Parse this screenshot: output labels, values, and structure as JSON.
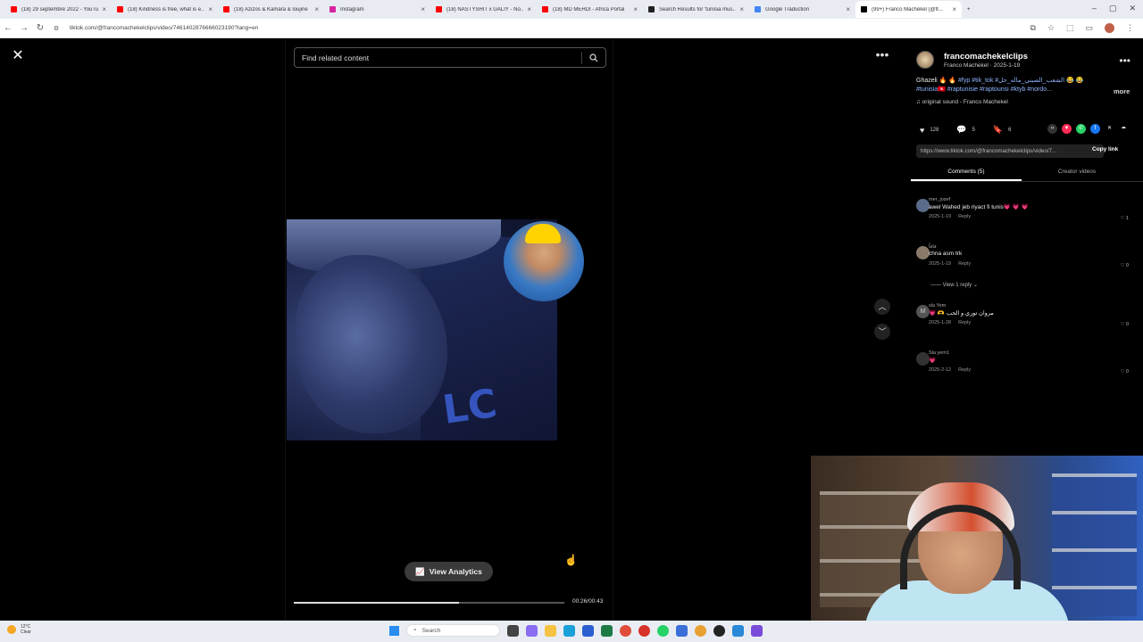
{
  "browser": {
    "tabs": [
      {
        "label": "(18) 29 septembre 2022 - YouTube",
        "color": "#ff0000"
      },
      {
        "label": "(18) Kindness is free, what is e...",
        "color": "#ff0000"
      },
      {
        "label": "(18) Azizos & Kamara & loujine",
        "color": "#ff0000"
      },
      {
        "label": "Instagram",
        "color": "#d6249f"
      },
      {
        "label": "(18) NASTYSHIT x GALIY - No...",
        "color": "#ff0000"
      },
      {
        "label": "(18) MD MEHDI - Africa Portal",
        "color": "#ff0000"
      },
      {
        "label": "Search Results for 'tunisia mus...",
        "color": "#222222"
      },
      {
        "label": "Google Traduction",
        "color": "#4285f4"
      },
      {
        "label": "(99+) Franco Machekel (@fr...",
        "color": "#000000"
      }
    ],
    "url": "tiktok.com/@francomachekelclips/video/7461402876666023190?lang=en"
  },
  "player": {
    "search_placeholder": "Find related content",
    "analytics_label": "View Analytics",
    "time": "00:26/00:43",
    "progress": 0.61
  },
  "video_overlay_text": "LC",
  "post": {
    "username": "francomachekelclips",
    "sub": "Franco  Machekel · 2025-1-19",
    "caption_plain": "Ghazeli 🔥 🔥 ",
    "caption_tags": "#fyp #tik_tok #الشعب_الصيني_ماله_حل 😂 😂 #tunisia🇹🇳 #raptunisie #raptounsi #ktyb #nordo...",
    "more_label": "more",
    "sound": "♫  original sound - Franco  Machekel",
    "likes": "128",
    "comments": "5",
    "saves": "6",
    "link": "https://www.tiktok.com/@francomachekelclips/video/7...",
    "copy_label": "Copy link",
    "tab_comments": "Comments (5)",
    "tab_videos": "Creator videos"
  },
  "comments": [
    {
      "user": "mer_jozef",
      "text": "awel Wahed jeb riyact fi tunis💗 💗 💗",
      "date": "2025-1-19",
      "reply": "Reply",
      "likes": "♡ 1"
    },
    {
      "user": "⁣⁣فافاً",
      "text": "chna asm trk",
      "date": "2025-1-19",
      "reply": "Reply",
      "likes": "♡ 0"
    },
    {
      "user": "sla Yem",
      "text": "💗 🫶 مروان توري و الحب",
      "date": "2025-1-28",
      "reply": "Reply",
      "likes": "♡ 0"
    },
    {
      "user": "Sla yem1",
      "text": "💗",
      "date": "2025-2-12",
      "reply": "Reply",
      "likes": "♡ 0"
    }
  ],
  "view_replies": "—— View 1 reply ⌄",
  "taskbar": {
    "temp": "12°C",
    "weather": "Clear",
    "search": "Search"
  }
}
